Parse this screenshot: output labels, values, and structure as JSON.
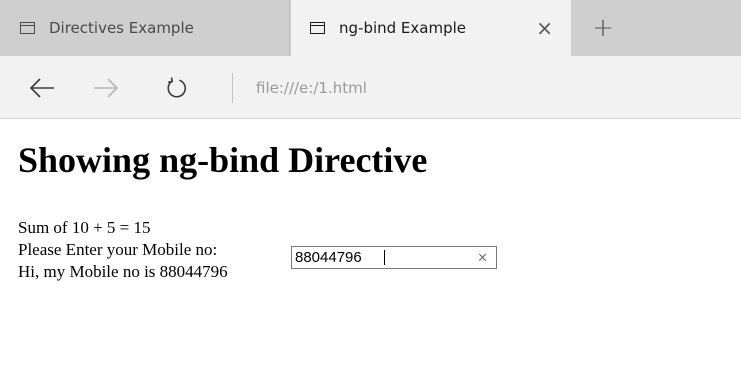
{
  "tabs": [
    {
      "label": "Directives Example",
      "active": false
    },
    {
      "label": "ng-bind Example",
      "active": true
    }
  ],
  "tab_controls": {
    "close_glyph": "×",
    "new_tab_glyph": "+"
  },
  "nav": {
    "back_icon": "arrow-left-icon",
    "forward_icon": "arrow-right-icon",
    "refresh_icon": "refresh-icon",
    "address": "file:///e:/1.html"
  },
  "page": {
    "title": "Showing ng-bind Directive",
    "sum_text": "Sum of 10 + 5 = 15",
    "prompt_label": "Please Enter your Mobile no:",
    "mobile_value": "88044796",
    "clear_glyph": "×",
    "echo_text": "Hi, my Mobile no is 88044796"
  },
  "colors": {
    "tabstrip_bg": "#cfcfcf",
    "active_tab_bg": "#f2f2f2",
    "address_text": "#9a9a9a",
    "nav_forward_disabled": "#b5b5b5"
  }
}
